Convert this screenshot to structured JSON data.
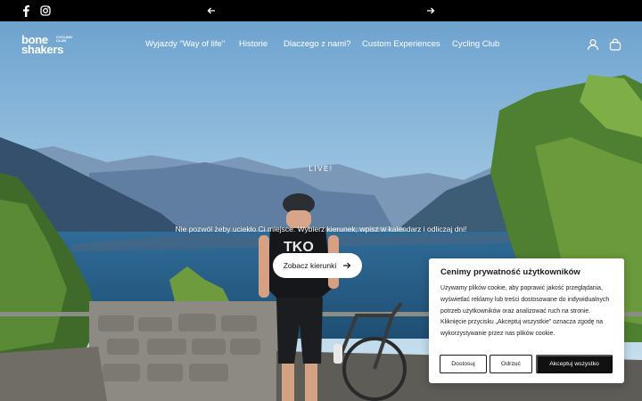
{
  "topbar": {
    "social": [
      {
        "name": "facebook-icon"
      },
      {
        "name": "instagram-icon"
      }
    ],
    "prev_icon": "arrow-left-icon",
    "next_icon": "arrow-right-icon"
  },
  "header": {
    "logo": {
      "line1": "bone",
      "line2": "shakers",
      "tag": "CYCLING CLUB"
    },
    "nav": [
      "Wyjazdy \"Way of life\"",
      "Historie",
      "Dlaczego z nami?",
      "Custom Experiences",
      "Cycling Club"
    ],
    "icons": [
      "user-icon",
      "bag-icon"
    ]
  },
  "hero": {
    "eyebrow": "LIVE!",
    "subtitle": "Nie pozwól żeby uciekło Ci miejsce. Wybierz kierunek, wpisz w kalendarz i odliczaj dni!",
    "cta_label": "Zobacz kierunki"
  },
  "cookie": {
    "title": "Cenimy prywatność użytkowników",
    "body": "Używamy plików cookie, aby poprawić jakość przeglądania, wyświetlać reklamy lub treści dostosowane do indywidualnych potrzeb użytkowników oraz analizować ruch na stronie. Kliknięcie przycisku „Akceptuj wszystkie\" oznacza zgodę na wykorzystywanie przez nas plików cookie.",
    "buttons": {
      "customize": "Dostosuj",
      "reject": "Odrzuć",
      "accept": "Akceptuj wszystko"
    }
  },
  "colors": {
    "topbar": "#000000",
    "cta_bg": "#ffffff",
    "accept_bg": "#111111"
  }
}
